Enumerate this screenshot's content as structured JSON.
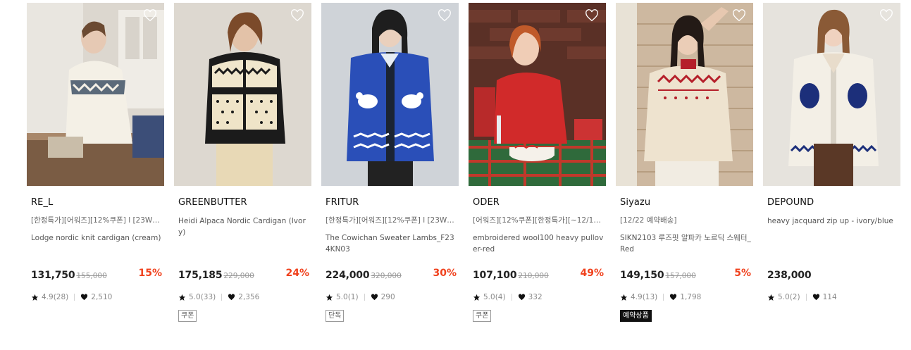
{
  "products": [
    {
      "brand": "RE_L",
      "promo": "[한정특가][어워즈][12%쿠폰] l [23WI...",
      "name": "Lodge nordic knit cardigan (cream)",
      "price": "131,750",
      "original_price": "155,000",
      "discount": "15%",
      "rating": "4.9(28)",
      "likes": "2,510",
      "tag": "",
      "image_alt": "woman in cream nordic cardigan by kitchen window"
    },
    {
      "brand": "GREENBUTTER",
      "promo": "",
      "name": "Heidi Alpaca Nordic Cardigan (Ivory)",
      "price": "175,185",
      "original_price": "229,000",
      "discount": "24%",
      "rating": "5.0(33)",
      "likes": "2,356",
      "tag": "쿠폰",
      "image_alt": "woman in black and cream alpaca nordic cardigan"
    },
    {
      "brand": "FRITUR",
      "promo": "[한정특가][어워즈][12%쿠폰] l [23WI...",
      "name": "The Cowichan Sweater Lambs_F234KN03",
      "price": "224,000",
      "original_price": "320,000",
      "discount": "30%",
      "rating": "5.0(1)",
      "likes": "290",
      "tag": "단독",
      "image_alt": "model in blue cowichan sweater with lamb motifs"
    },
    {
      "brand": "ODER",
      "promo": "[어워즈][12%쿠폰][한정특가][~12/12...",
      "name": "embroidered wool100 heavy pullover-red",
      "price": "107,100",
      "original_price": "210,000",
      "discount": "49%",
      "rating": "5.0(4)",
      "likes": "332",
      "tag": "쿠폰",
      "image_alt": "girl in red pullover at table with cake"
    },
    {
      "brand": "Siyazu",
      "promo": "[12/22 예약배송]",
      "name": "SIKN2103 루즈핏 알파카 노르딕 스웨터_Red",
      "price": "149,150",
      "original_price": "157,000",
      "discount": "5%",
      "rating": "4.9(13)",
      "likes": "1,798",
      "tag": "예약상품",
      "image_alt": "woman in beige nordic sweater with red pattern"
    },
    {
      "brand": "DEPOUND",
      "promo": "",
      "name": "heavy jacquard zip up - ivory/blue",
      "price": "238,000",
      "original_price": "",
      "discount": "",
      "rating": "5.0(2)",
      "likes": "114",
      "tag": "",
      "image_alt": "woman in ivory zip up with blue bird jacquard"
    }
  ],
  "colors": {
    "discount": "#f0411d",
    "price": "#222222",
    "meta": "#8a8a8a",
    "tag_black_bg": "#111111"
  },
  "icons": {
    "wishlist": "heart-outline-icon",
    "rating": "star-icon",
    "likes": "heart-filled-icon"
  }
}
